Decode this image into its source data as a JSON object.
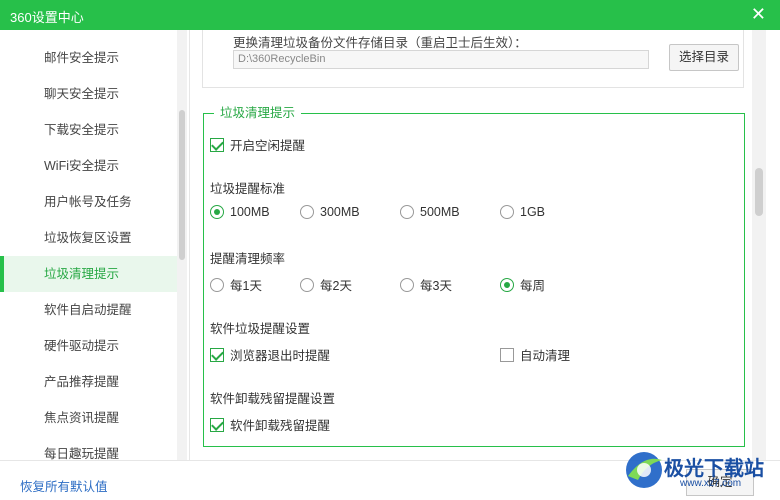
{
  "window": {
    "title": "360设置中心",
    "close_glyph": "✕"
  },
  "sidebar": {
    "active_index": 6,
    "items": [
      {
        "label": "邮件安全提示"
      },
      {
        "label": "聊天安全提示"
      },
      {
        "label": "下载安全提示"
      },
      {
        "label": "WiFi安全提示"
      },
      {
        "label": "用户帐号及任务"
      },
      {
        "label": "垃圾恢复区设置"
      },
      {
        "label": "垃圾清理提示"
      },
      {
        "label": "软件自启动提醒"
      },
      {
        "label": "硬件驱动提示"
      },
      {
        "label": "产品推荐提醒"
      },
      {
        "label": "焦点资讯提醒"
      },
      {
        "label": "每日趣玩提醒"
      }
    ]
  },
  "backup": {
    "label": "更换清理垃圾备份文件存储目录（重启卫士后生效）：",
    "path": "D:\\360RecycleBin",
    "choose_label": "选择目录"
  },
  "junk": {
    "title": "垃圾清理提示",
    "idle_reminder": {
      "label": "开启空闲提醒",
      "checked": true
    },
    "standard": {
      "title": "垃圾提醒标准",
      "selected": "100MB",
      "options": [
        "100MB",
        "300MB",
        "500MB",
        "1GB"
      ]
    },
    "frequency": {
      "title": "提醒清理频率",
      "selected": "每周",
      "options": [
        "每1天",
        "每2天",
        "每3天",
        "每周"
      ]
    },
    "software": {
      "title": "软件垃圾提醒设置",
      "browser_exit": {
        "label": "浏览器退出时提醒",
        "checked": true
      },
      "auto_clean": {
        "label": "自动清理",
        "checked": false
      }
    },
    "uninstall": {
      "title": "软件卸载残留提醒设置",
      "residual": {
        "label": "软件卸载残留提醒",
        "checked": true
      }
    }
  },
  "footer": {
    "reset_label": "恢复所有默认值",
    "ok_label": "确定"
  },
  "watermark": {
    "text": "极光下载站",
    "url": "www.xz7.com"
  },
  "colors": {
    "accent": "#27c04a",
    "link": "#2b6cc4"
  },
  "icons": {
    "close": "close-icon",
    "checkbox": "check-icon",
    "radio": "radio-dot-icon"
  }
}
